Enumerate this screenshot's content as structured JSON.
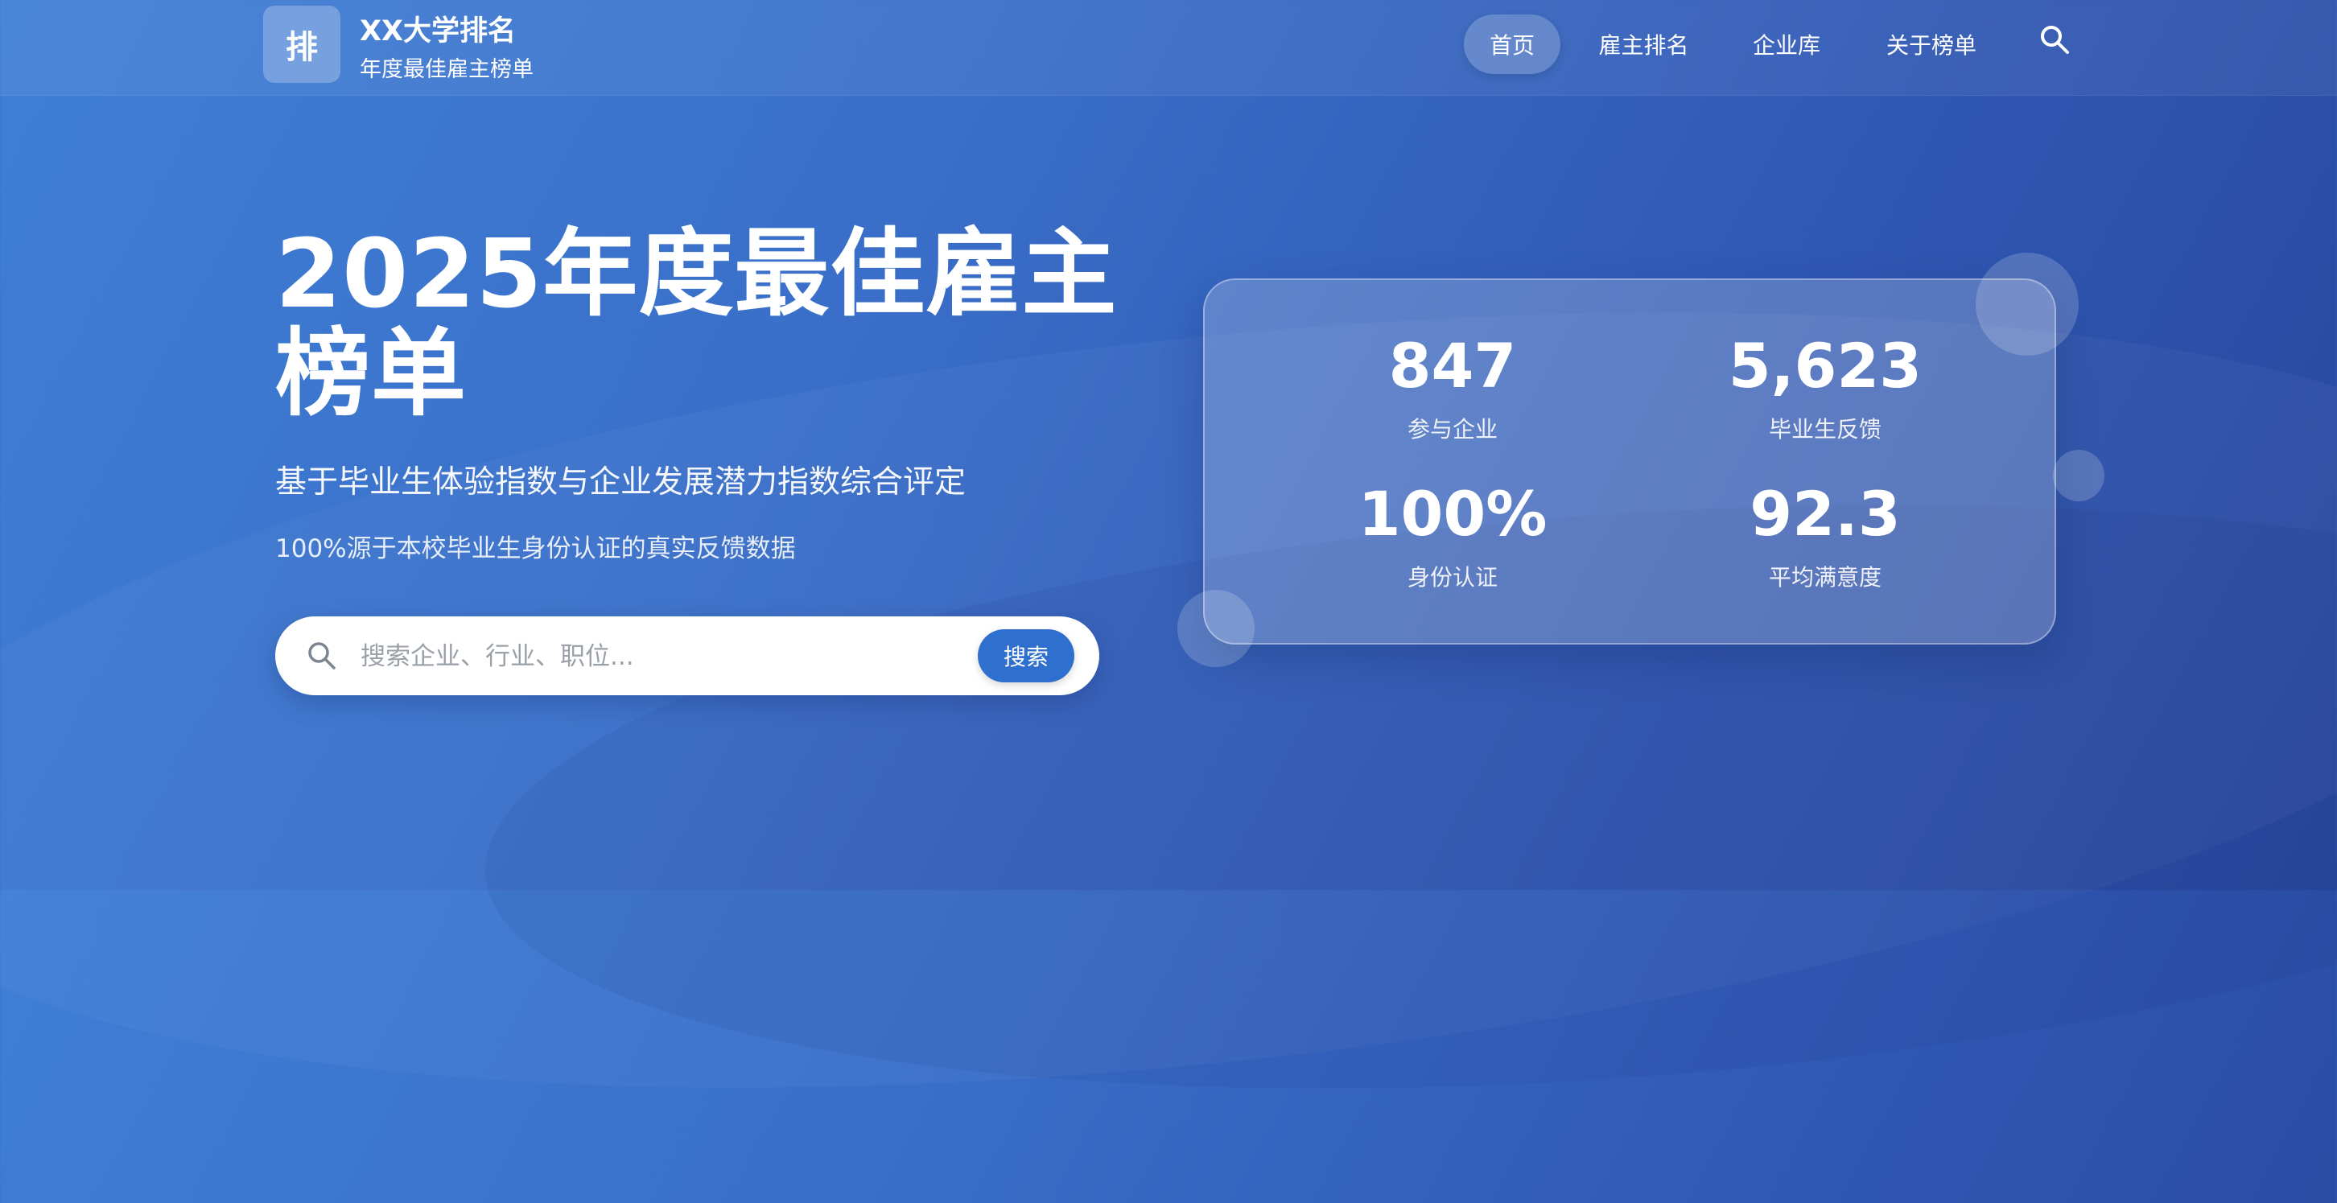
{
  "brand": {
    "logo_char": "排",
    "title": "XX大学排名",
    "subtitle": "年度最佳雇主榜单"
  },
  "nav": {
    "items": [
      "首页",
      "雇主排名",
      "企业库",
      "关于榜单"
    ],
    "active": "首页"
  },
  "hero": {
    "title_line1": "2025年度最佳雇主",
    "title_line2": "榜单",
    "subtitle": "基于毕业生体验指数与企业发展潜力指数综合评定",
    "description": "100%源于本校毕业生身份认证的真实反馈数据"
  },
  "search": {
    "placeholder": "搜索企业、行业、职位...",
    "button_label": "搜索"
  },
  "stats": [
    {
      "value": "847",
      "label": "参与企业"
    },
    {
      "value": "5,623",
      "label": "毕业生反馈"
    },
    {
      "value": "100%",
      "label": "身份认证"
    },
    {
      "value": "92.3",
      "label": "平均满意度"
    }
  ],
  "icons": {
    "logo": "logo-icon",
    "nav_search": "search-icon",
    "bar_search": "search-icon"
  },
  "colors": {
    "primary": "#2f6fce",
    "background_start": "#3f7fd6",
    "background_end": "#28479c"
  }
}
